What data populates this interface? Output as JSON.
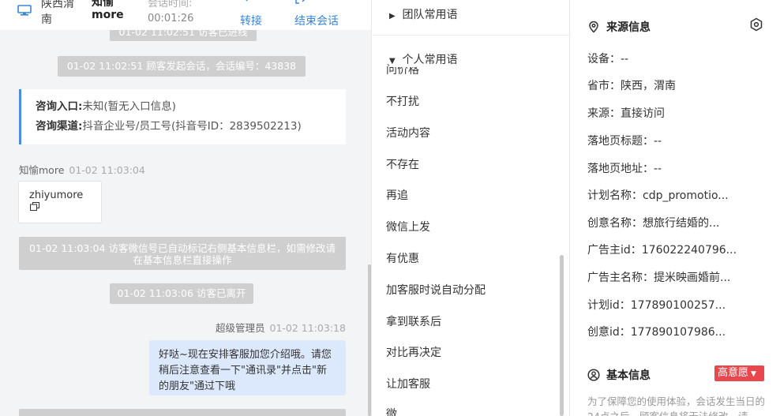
{
  "header": {
    "location": "陕西渭南",
    "nickname": "知愉more",
    "session_label": "会话时间:",
    "session_time": "00:01:26",
    "transfer_label": "转接",
    "end_label": "结束会话"
  },
  "chat": {
    "sys1": "01-02 11:02:51 访客已进线",
    "sys2": "01-02 11:02:51 顾客发起会话，会话编号：43838",
    "card": {
      "entry_label": "咨询入口:",
      "entry_value": "未知(暂无入口信息)",
      "channel_label": "咨询渠道:",
      "channel_value": "抖音企业号/员工号(抖音号ID：2839502213)"
    },
    "visitor_msg": {
      "sender": "知愉more",
      "time": "01-02 11:03:04",
      "text": "zhiyumore"
    },
    "sys3": "01-02 11:03:04 访客微信号已自动标记右侧基本信息栏，如需修改请在基本信息栏直接操作",
    "sys4": "01-02 11:03:06 访客已离开",
    "agent_msg": {
      "sender": "超级管理员",
      "time": "01-02 11:03:18",
      "text": "好哒~现在安排客服加您介绍哦。请您稍后注意查看一下\"通讯录\"并点击\"新的朋友\"通过下哦"
    }
  },
  "phrases": {
    "team_group": "团队常用语",
    "personal_group": "个人常用语",
    "items": [
      "问价格",
      "不打扰",
      "活动内容",
      "不存在",
      "再追",
      "微信上发",
      "有优惠",
      "加客服时说自动分配",
      "拿到联系后",
      "对比再决定",
      "让加客服",
      "微"
    ]
  },
  "source": {
    "title": "来源信息",
    "rows": [
      "设备：--",
      "省市：陕西，渭南",
      "来源：直接访问",
      "落地页标题：--",
      "落地页地址：--",
      "计划名称：cdp_promotio...",
      "创意名称：想旅行结婚的...",
      "广告主id：176022240796...",
      "广告主名称：提米映画婚前...",
      "计划id：177890100257...",
      "创意id：177890107986..."
    ]
  },
  "basic": {
    "title": "基本信息",
    "badge": "高意愿",
    "note": "为了保障您的使用体验，会话发生当日的24点之后，顾客信息将无法修改，请"
  },
  "colors": {
    "accent": "#3a86d6",
    "badge": "#e8484d",
    "bubble": "#dce8fb"
  }
}
